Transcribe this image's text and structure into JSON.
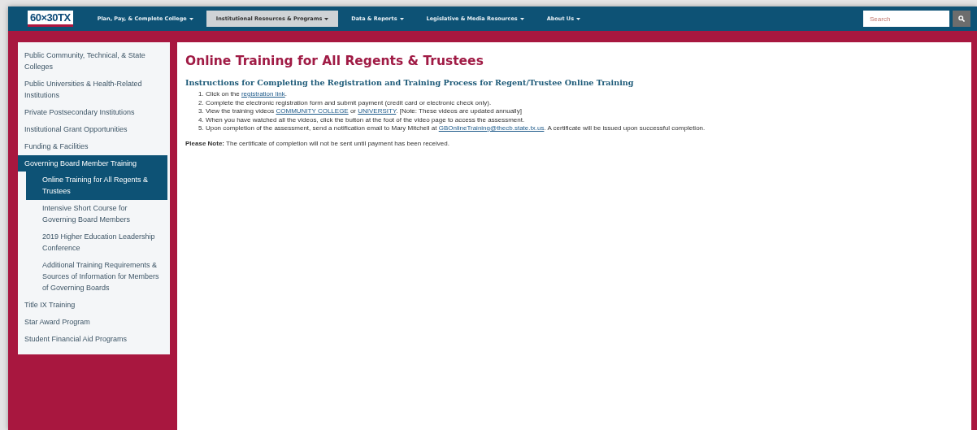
{
  "nav": {
    "logo": "60×30TX",
    "items": [
      {
        "label": "Plan, Pay, & Complete College",
        "selected": false
      },
      {
        "label": "Institutional Resources & Programs",
        "selected": true
      },
      {
        "label": "Data & Reports",
        "selected": false
      },
      {
        "label": "Legislative & Media Resources",
        "selected": false
      },
      {
        "label": "About Us",
        "selected": false
      }
    ],
    "search": {
      "placeholder": "Search"
    }
  },
  "sidebar": {
    "items": [
      {
        "label": "Public Community, Technical, & State Colleges",
        "selected": false
      },
      {
        "label": "Public Universities & Health-Related Institutions",
        "selected": false
      },
      {
        "label": "Private Postsecondary Institutions",
        "selected": false
      },
      {
        "label": "Institutional Grant Opportunities",
        "selected": false
      },
      {
        "label": "Funding & Facilities",
        "selected": false
      },
      {
        "label": "Governing Board Member Training",
        "selected": true,
        "children": [
          {
            "label": "Online Training for All Regents & Trustees",
            "selected": true
          },
          {
            "label": "Intensive Short Course for Governing Board Members",
            "selected": false
          },
          {
            "label": "2019 Higher Education Leadership Conference",
            "selected": false
          },
          {
            "label": "Additional Training Requirements & Sources of Information for Members of Governing Boards",
            "selected": false
          }
        ]
      },
      {
        "label": "Title IX Training",
        "selected": false
      },
      {
        "label": "Star Award Program",
        "selected": false
      },
      {
        "label": "Student Financial Aid Programs",
        "selected": false
      }
    ]
  },
  "content": {
    "title": "Online Training for All Regents & Trustees",
    "subtitle": "Instructions for Completing the Registration and Training Process for Regent/Trustee Online Training",
    "steps": [
      {
        "number": "1.",
        "parts": [
          {
            "kind": "text",
            "text": "Click on the "
          },
          {
            "kind": "link",
            "text": "registration link"
          },
          {
            "kind": "text",
            "text": "."
          }
        ]
      },
      {
        "number": "2.",
        "parts": [
          {
            "kind": "text",
            "text": "Complete the electronic registration form and submit payment (credit card or electronic check only)."
          }
        ]
      },
      {
        "number": "3.",
        "parts": [
          {
            "kind": "text",
            "text": "View the training videos "
          },
          {
            "kind": "link",
            "text": "COMMUNITY COLLEGE"
          },
          {
            "kind": "text",
            "text": " or "
          },
          {
            "kind": "link",
            "text": "UNIVERSITY"
          },
          {
            "kind": "text",
            "text": ". [Note: These videos are updated annually]"
          }
        ]
      },
      {
        "number": "4.",
        "parts": [
          {
            "kind": "text",
            "text": "When you have watched all the videos, click the button at the foot of the video page to access the assessment."
          }
        ]
      },
      {
        "number": "5.",
        "parts": [
          {
            "kind": "text",
            "text": "Upon completion of the assessment, send a notification email to Mary Mitchell at "
          },
          {
            "kind": "link",
            "text": "GBOnlineTraining@thecb.state.tx.us"
          },
          {
            "kind": "text",
            "text": ". A certificate will be issued upon successful completion."
          }
        ]
      }
    ],
    "note": "**Please Note:** The certificate of completion will not be sent until payment has been received."
  }
}
